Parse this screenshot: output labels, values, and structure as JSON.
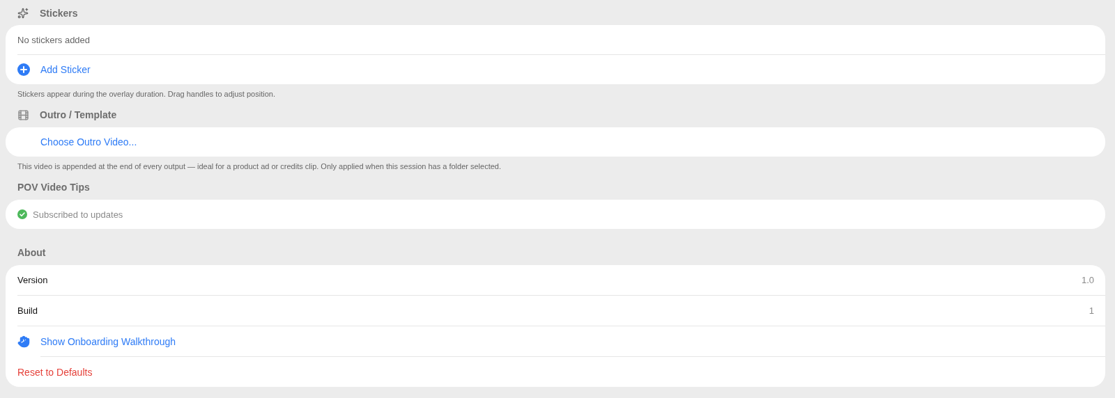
{
  "sections": [
    {
      "title": "Stickers",
      "rows": [
        {
          "kind": "text",
          "label": "No stickers added"
        },
        {
          "kind": "action",
          "label": "Add Sticker"
        }
      ],
      "footer": "Stickers appear during the overlay duration. Drag handles to adjust position."
    },
    {
      "title": "Outro / Template",
      "rows": [
        {
          "kind": "action",
          "label": "Choose Outro Video..."
        }
      ],
      "footer": "This video is appended at the end of every output — ideal for a product ad or credits clip. Only applied when this session has a folder selected."
    },
    {
      "title": "POV Video Tips",
      "rows": [
        {
          "kind": "status",
          "label": "Subscribed to updates",
          "checked": true
        }
      ]
    },
    {
      "title": "About",
      "rows": [
        {
          "kind": "value",
          "label": "Version",
          "value": "1.0"
        },
        {
          "kind": "value",
          "label": "Build",
          "value": "1"
        },
        {
          "kind": "action",
          "label": "Show Onboarding Walkthrough"
        },
        {
          "kind": "destructive",
          "label": "Reset to Defaults"
        }
      ]
    }
  ]
}
